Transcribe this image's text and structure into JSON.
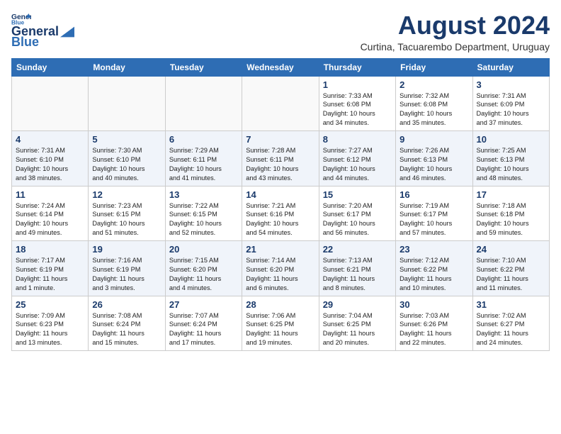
{
  "header": {
    "logo_line1": "General",
    "logo_line2": "Blue",
    "main_title": "August 2024",
    "subtitle": "Curtina, Tacuarembo Department, Uruguay"
  },
  "days_of_week": [
    "Sunday",
    "Monday",
    "Tuesday",
    "Wednesday",
    "Thursday",
    "Friday",
    "Saturday"
  ],
  "weeks": [
    [
      {
        "day": "",
        "info": ""
      },
      {
        "day": "",
        "info": ""
      },
      {
        "day": "",
        "info": ""
      },
      {
        "day": "",
        "info": ""
      },
      {
        "day": "1",
        "info": "Sunrise: 7:33 AM\nSunset: 6:08 PM\nDaylight: 10 hours\nand 34 minutes."
      },
      {
        "day": "2",
        "info": "Sunrise: 7:32 AM\nSunset: 6:08 PM\nDaylight: 10 hours\nand 35 minutes."
      },
      {
        "day": "3",
        "info": "Sunrise: 7:31 AM\nSunset: 6:09 PM\nDaylight: 10 hours\nand 37 minutes."
      }
    ],
    [
      {
        "day": "4",
        "info": "Sunrise: 7:31 AM\nSunset: 6:10 PM\nDaylight: 10 hours\nand 38 minutes."
      },
      {
        "day": "5",
        "info": "Sunrise: 7:30 AM\nSunset: 6:10 PM\nDaylight: 10 hours\nand 40 minutes."
      },
      {
        "day": "6",
        "info": "Sunrise: 7:29 AM\nSunset: 6:11 PM\nDaylight: 10 hours\nand 41 minutes."
      },
      {
        "day": "7",
        "info": "Sunrise: 7:28 AM\nSunset: 6:11 PM\nDaylight: 10 hours\nand 43 minutes."
      },
      {
        "day": "8",
        "info": "Sunrise: 7:27 AM\nSunset: 6:12 PM\nDaylight: 10 hours\nand 44 minutes."
      },
      {
        "day": "9",
        "info": "Sunrise: 7:26 AM\nSunset: 6:13 PM\nDaylight: 10 hours\nand 46 minutes."
      },
      {
        "day": "10",
        "info": "Sunrise: 7:25 AM\nSunset: 6:13 PM\nDaylight: 10 hours\nand 48 minutes."
      }
    ],
    [
      {
        "day": "11",
        "info": "Sunrise: 7:24 AM\nSunset: 6:14 PM\nDaylight: 10 hours\nand 49 minutes."
      },
      {
        "day": "12",
        "info": "Sunrise: 7:23 AM\nSunset: 6:15 PM\nDaylight: 10 hours\nand 51 minutes."
      },
      {
        "day": "13",
        "info": "Sunrise: 7:22 AM\nSunset: 6:15 PM\nDaylight: 10 hours\nand 52 minutes."
      },
      {
        "day": "14",
        "info": "Sunrise: 7:21 AM\nSunset: 6:16 PM\nDaylight: 10 hours\nand 54 minutes."
      },
      {
        "day": "15",
        "info": "Sunrise: 7:20 AM\nSunset: 6:17 PM\nDaylight: 10 hours\nand 56 minutes."
      },
      {
        "day": "16",
        "info": "Sunrise: 7:19 AM\nSunset: 6:17 PM\nDaylight: 10 hours\nand 57 minutes."
      },
      {
        "day": "17",
        "info": "Sunrise: 7:18 AM\nSunset: 6:18 PM\nDaylight: 10 hours\nand 59 minutes."
      }
    ],
    [
      {
        "day": "18",
        "info": "Sunrise: 7:17 AM\nSunset: 6:19 PM\nDaylight: 11 hours\nand 1 minute."
      },
      {
        "day": "19",
        "info": "Sunrise: 7:16 AM\nSunset: 6:19 PM\nDaylight: 11 hours\nand 3 minutes."
      },
      {
        "day": "20",
        "info": "Sunrise: 7:15 AM\nSunset: 6:20 PM\nDaylight: 11 hours\nand 4 minutes."
      },
      {
        "day": "21",
        "info": "Sunrise: 7:14 AM\nSunset: 6:20 PM\nDaylight: 11 hours\nand 6 minutes."
      },
      {
        "day": "22",
        "info": "Sunrise: 7:13 AM\nSunset: 6:21 PM\nDaylight: 11 hours\nand 8 minutes."
      },
      {
        "day": "23",
        "info": "Sunrise: 7:12 AM\nSunset: 6:22 PM\nDaylight: 11 hours\nand 10 minutes."
      },
      {
        "day": "24",
        "info": "Sunrise: 7:10 AM\nSunset: 6:22 PM\nDaylight: 11 hours\nand 11 minutes."
      }
    ],
    [
      {
        "day": "25",
        "info": "Sunrise: 7:09 AM\nSunset: 6:23 PM\nDaylight: 11 hours\nand 13 minutes."
      },
      {
        "day": "26",
        "info": "Sunrise: 7:08 AM\nSunset: 6:24 PM\nDaylight: 11 hours\nand 15 minutes."
      },
      {
        "day": "27",
        "info": "Sunrise: 7:07 AM\nSunset: 6:24 PM\nDaylight: 11 hours\nand 17 minutes."
      },
      {
        "day": "28",
        "info": "Sunrise: 7:06 AM\nSunset: 6:25 PM\nDaylight: 11 hours\nand 19 minutes."
      },
      {
        "day": "29",
        "info": "Sunrise: 7:04 AM\nSunset: 6:25 PM\nDaylight: 11 hours\nand 20 minutes."
      },
      {
        "day": "30",
        "info": "Sunrise: 7:03 AM\nSunset: 6:26 PM\nDaylight: 11 hours\nand 22 minutes."
      },
      {
        "day": "31",
        "info": "Sunrise: 7:02 AM\nSunset: 6:27 PM\nDaylight: 11 hours\nand 24 minutes."
      }
    ]
  ]
}
